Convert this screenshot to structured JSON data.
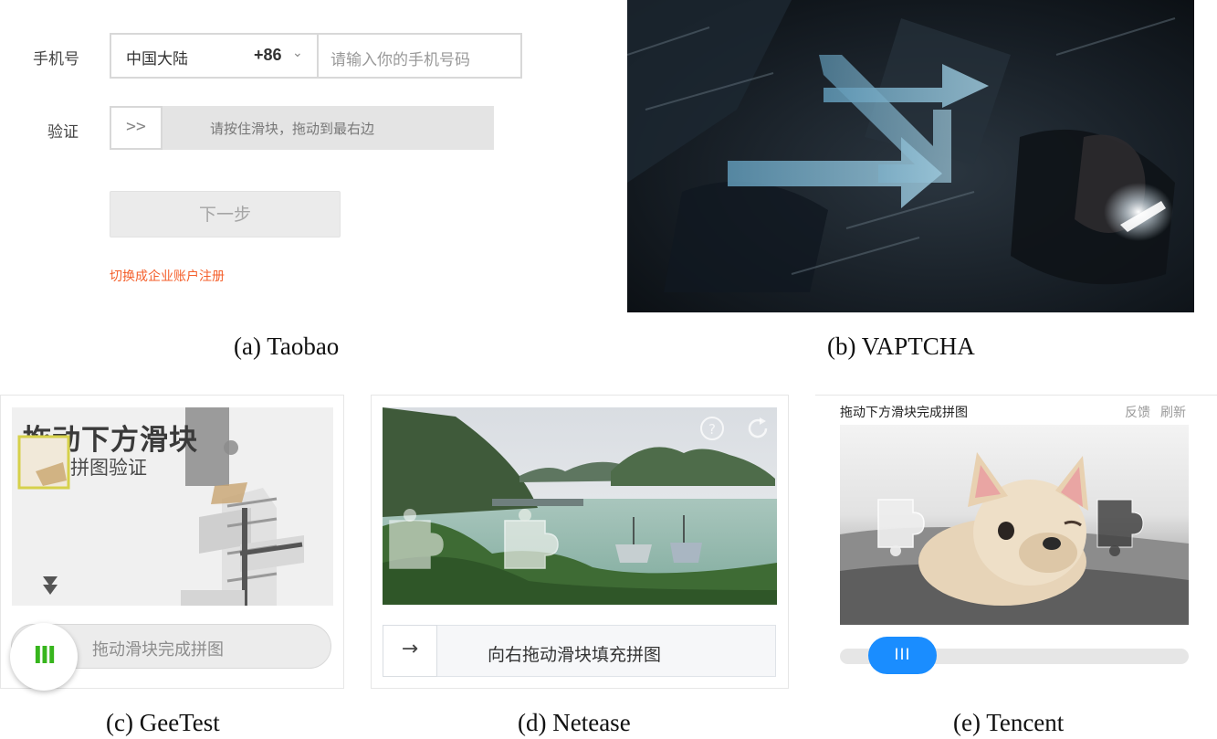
{
  "taobao": {
    "phone_label": "手机号",
    "region": "中国大陆",
    "country_code": "+86",
    "phone_placeholder": "请输入你的手机号码",
    "verify_label": "验证",
    "slider_knob": ">>",
    "slider_text": "请按住滑块，拖动到最右边",
    "next_button": "下一步",
    "switch_link": "切换成企业账户注册",
    "accent_color": "#f45f2b"
  },
  "captions": {
    "a": "(a) Taobao",
    "b": "(b) VAPTCHA",
    "c": "(c) GeeTest",
    "d": "(d) Netease",
    "e": "(e) Tencent"
  },
  "geetest": {
    "image_title": "拖动下方滑块",
    "image_subtitle": "拼图验证",
    "knob_glyph": "III",
    "slider_text": "拖动滑块完成拼图",
    "accent_color": "#37b51d"
  },
  "netease": {
    "slider_text": "向右拖动滑块填充拼图",
    "knob_glyph": "→",
    "help_icon": "question-icon",
    "refresh_icon": "refresh-icon"
  },
  "tencent": {
    "title": "拖动下方滑块完成拼图",
    "feedback": "反馈",
    "refresh": "刷新",
    "knob_glyph": "III",
    "accent_color": "#1a8dff"
  }
}
